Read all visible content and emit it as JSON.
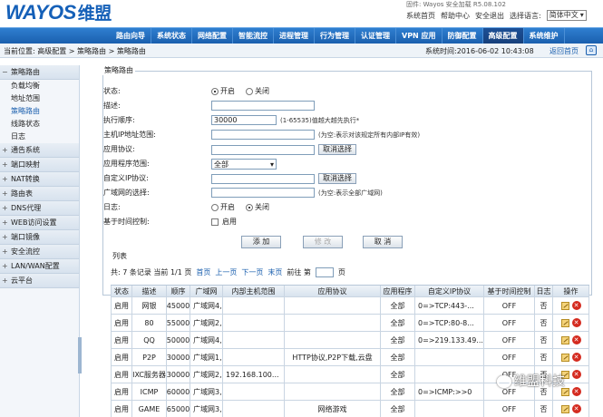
{
  "brand": {
    "logo_text": "WAYOS",
    "logo_cn": "维盟"
  },
  "top": {
    "info_line": "固件: Wayos 安全加载 R5.08.102",
    "links": [
      "系统首页",
      "帮助中心",
      "安全退出"
    ],
    "lang_label": "选择语言:",
    "lang_value": "简体中文"
  },
  "nav": {
    "items": [
      "路由向导",
      "系统状态",
      "网络配置",
      "智能流控",
      "进程管理",
      "行为管理",
      "认证管理",
      "VPN 应用",
      "防御配置",
      "高级配置",
      "系统维护"
    ],
    "active_index": 9
  },
  "breadcrumb": {
    "label": "当前位置:",
    "path": [
      "高级配置",
      "策略路由",
      "策略路由"
    ],
    "time_label": "系统时间:",
    "time_value": "2016-06-02 10:43:08",
    "back_label": "返回首页"
  },
  "sidebar": {
    "top_group": "策略路由",
    "sub_items": [
      "负载均衡",
      "地址范围",
      "策略路由",
      "线路状态",
      "日志"
    ],
    "active_sub": 2,
    "groups": [
      "通告系统",
      "端口映射",
      "NAT转换",
      "路由表",
      "DNS代理",
      "WEB访问设置",
      "端口镜像",
      "安全流控",
      "LAN/WAN配置",
      "云平台"
    ]
  },
  "form": {
    "legend": "策略路由",
    "fields": {
      "status": {
        "label": "状态:",
        "on": "开启",
        "off": "关闭",
        "value": "on"
      },
      "desc": {
        "label": "描述:",
        "value": ""
      },
      "order": {
        "label": "执行顺序:",
        "value": "30000",
        "hint": "(1-65535)值越大越先执行*"
      },
      "host_ip": {
        "label": "主机IP地址范围:",
        "value": "",
        "hint": "(为空:表示对该规定所有内部IP有效)"
      },
      "app_proto": {
        "label": "应用协议:",
        "value": "",
        "btn": "取消选择"
      },
      "app_range": {
        "label": "应用程序范围:",
        "value": "全部"
      },
      "custom_ip": {
        "label": "自定义IP协议:",
        "value": "",
        "btn": "取消选择"
      },
      "wan": {
        "label": "广域网的选择:",
        "value": "",
        "hint": "(为空:表示全部广域网)"
      },
      "log": {
        "label": "日志:",
        "on": "开启",
        "off": "关闭",
        "value": "off"
      },
      "time_ctl": {
        "label": "基于时间控制:",
        "enable": "启用"
      }
    },
    "buttons": {
      "add": "添 加",
      "modify": "修 改",
      "cancel": "取 消"
    }
  },
  "list": {
    "legend": "列表",
    "pager": {
      "summary": "共: 7 条记录 当前 1/1 页",
      "first": "首页",
      "prev": "上一页",
      "next": "下一页",
      "last": "末页",
      "goto": "前往 第",
      "page": "页"
    },
    "columns": [
      "状态",
      "描述",
      "顺序",
      "广域网",
      "内部主机范围",
      "应用协议",
      "应用程序",
      "自定义IP协议",
      "基于时间控制",
      "日志",
      "操作"
    ],
    "rows": [
      [
        "启用",
        "网银",
        "45000",
        "广域网4,",
        "",
        "",
        "全部",
        "0=>TCP:443-...",
        "OFF",
        "否"
      ],
      [
        "启用",
        "80",
        "55000",
        "广域网2,",
        "",
        "",
        "全部",
        "0=>TCP:80-8...",
        "OFF",
        "否"
      ],
      [
        "启用",
        "QQ",
        "50000",
        "广域网4,",
        "",
        "",
        "全部",
        "0=>219.133.49...",
        "OFF",
        "否"
      ],
      [
        "启用",
        "P2P",
        "30000",
        "广域网1,",
        "",
        "HTTP协议,P2P下载,云盘",
        "全部",
        "",
        "OFF",
        "否"
      ],
      [
        "启用",
        "IXC服务器",
        "30000",
        "广域网2,",
        "192.168.100...",
        "",
        "全部",
        "",
        "OFF",
        "否"
      ],
      [
        "启用",
        "ICMP",
        "60000",
        "广域网3,",
        "",
        "",
        "全部",
        "0=>ICMP:>>0",
        "OFF",
        "否"
      ],
      [
        "启用",
        "GAME",
        "65000",
        "广域网3,",
        "",
        "网络游戏",
        "全部",
        "",
        "OFF",
        "否"
      ]
    ]
  },
  "watermark": "维盟科技"
}
